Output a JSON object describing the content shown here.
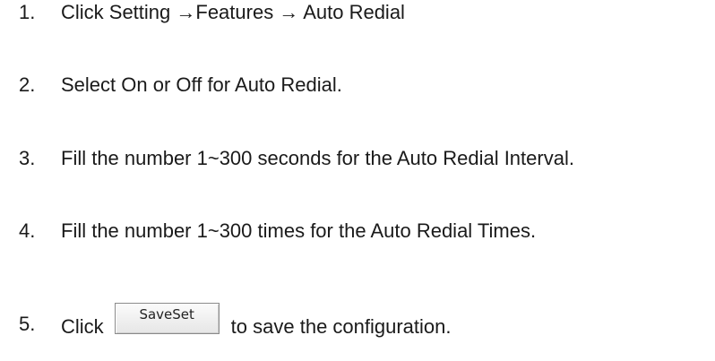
{
  "steps": [
    {
      "number": "1.",
      "text": "Click Setting →Features → Auto Redial"
    },
    {
      "number": "2.",
      "text": "Select On or Off for Auto Redial."
    },
    {
      "number": "3.",
      "text": "Fill the number 1~300 seconds for the Auto Redial Interval."
    },
    {
      "number": "4.",
      "text": "Fill the number 1~300 times for the Auto Redial Times."
    },
    {
      "number": "5.",
      "text_before": "Click",
      "button_label": "SaveSet",
      "text_after": "to save the configuration."
    }
  ]
}
